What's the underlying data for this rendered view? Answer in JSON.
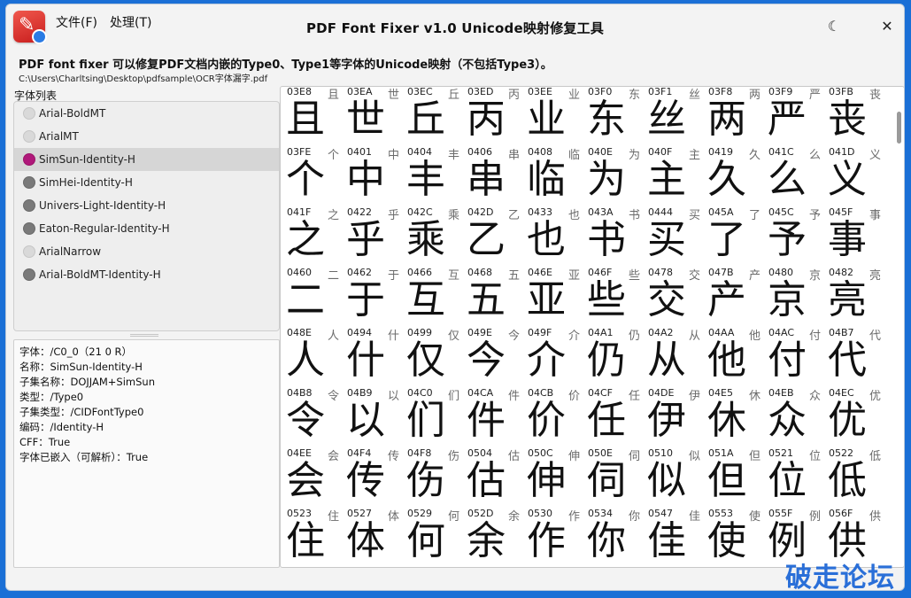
{
  "window": {
    "title": "PDF Font Fixer v1.0  Unicode映射修复工具",
    "menu": [
      "文件(F)",
      "处理(T)"
    ],
    "theme_icon": "moon-icon",
    "close_icon": "close-icon"
  },
  "header": {
    "description": "PDF font fixer 可以修复PDF文档内嵌的Type0、Type1等字体的Unicode映射（不包括Type3）。",
    "path": "C:\\Users\\Charltsing\\Desktop\\pdfsample\\OCR字体漏字.pdf"
  },
  "font_list": {
    "label": "字体列表",
    "items": [
      {
        "name": "Arial-BoldMT",
        "state": "light"
      },
      {
        "name": "ArialMT",
        "state": "light"
      },
      {
        "name": "SimSun-Identity-H",
        "state": "selected"
      },
      {
        "name": "SimHei-Identity-H",
        "state": "dark"
      },
      {
        "name": "Univers-Light-Identity-H",
        "state": "dark"
      },
      {
        "name": "Eaton-Regular-Identity-H",
        "state": "dark"
      },
      {
        "name": "ArialNarrow",
        "state": "light"
      },
      {
        "name": "Arial-BoldMT-Identity-H",
        "state": "dark"
      }
    ]
  },
  "info": {
    "lines": [
      "字体：/C0_0（21 0 R）",
      "名称：SimSun-Identity-H",
      "子集名称：DOJJAM+SimSun",
      "类型：/Type0",
      "子集类型：/CIDFontType0",
      "编码：/Identity-H",
      "CFF：True",
      "字体已嵌入（可解析）：True"
    ]
  },
  "glyphs": [
    {
      "code": "03E8",
      "char": "且"
    },
    {
      "code": "03EA",
      "char": "世"
    },
    {
      "code": "03EC",
      "char": "丘"
    },
    {
      "code": "03ED",
      "char": "丙"
    },
    {
      "code": "03EE",
      "char": "业"
    },
    {
      "code": "03F0",
      "char": "东"
    },
    {
      "code": "03F1",
      "char": "丝"
    },
    {
      "code": "03F8",
      "char": "两"
    },
    {
      "code": "03F9",
      "char": "严"
    },
    {
      "code": "03FB",
      "char": "丧"
    },
    {
      "code": "03FE",
      "char": "个"
    },
    {
      "code": "0401",
      "char": "中"
    },
    {
      "code": "0404",
      "char": "丰"
    },
    {
      "code": "0406",
      "char": "串"
    },
    {
      "code": "0408",
      "char": "临"
    },
    {
      "code": "040E",
      "char": "为"
    },
    {
      "code": "040F",
      "char": "主"
    },
    {
      "code": "0419",
      "char": "久"
    },
    {
      "code": "041C",
      "char": "么"
    },
    {
      "code": "041D",
      "char": "义"
    },
    {
      "code": "041F",
      "char": "之"
    },
    {
      "code": "0422",
      "char": "乎"
    },
    {
      "code": "042C",
      "char": "乘"
    },
    {
      "code": "042D",
      "char": "乙"
    },
    {
      "code": "0433",
      "char": "也"
    },
    {
      "code": "043A",
      "char": "书"
    },
    {
      "code": "0444",
      "char": "买"
    },
    {
      "code": "045A",
      "char": "了"
    },
    {
      "code": "045C",
      "char": "予"
    },
    {
      "code": "045F",
      "char": "事"
    },
    {
      "code": "0460",
      "char": "二"
    },
    {
      "code": "0462",
      "char": "于"
    },
    {
      "code": "0466",
      "char": "互"
    },
    {
      "code": "0468",
      "char": "五"
    },
    {
      "code": "046E",
      "char": "亚"
    },
    {
      "code": "046F",
      "char": "些"
    },
    {
      "code": "0478",
      "char": "交"
    },
    {
      "code": "047B",
      "char": "产"
    },
    {
      "code": "0480",
      "char": "京"
    },
    {
      "code": "0482",
      "char": "亮"
    },
    {
      "code": "048E",
      "char": "人"
    },
    {
      "code": "0494",
      "char": "什"
    },
    {
      "code": "0499",
      "char": "仅"
    },
    {
      "code": "049E",
      "char": "今"
    },
    {
      "code": "049F",
      "char": "介"
    },
    {
      "code": "04A1",
      "char": "仍"
    },
    {
      "code": "04A2",
      "char": "从"
    },
    {
      "code": "04AA",
      "char": "他"
    },
    {
      "code": "04AC",
      "char": "付"
    },
    {
      "code": "04B7",
      "char": "代"
    },
    {
      "code": "04B8",
      "char": "令"
    },
    {
      "code": "04B9",
      "char": "以"
    },
    {
      "code": "04C0",
      "char": "们"
    },
    {
      "code": "04CA",
      "char": "件"
    },
    {
      "code": "04CB",
      "char": "价"
    },
    {
      "code": "04CF",
      "char": "任"
    },
    {
      "code": "04DE",
      "char": "伊"
    },
    {
      "code": "04E5",
      "char": "休"
    },
    {
      "code": "04EB",
      "char": "众"
    },
    {
      "code": "04EC",
      "char": "优"
    },
    {
      "code": "04EE",
      "char": "会"
    },
    {
      "code": "04F4",
      "char": "传"
    },
    {
      "code": "04F8",
      "char": "伤"
    },
    {
      "code": "0504",
      "char": "估"
    },
    {
      "code": "050C",
      "char": "伸"
    },
    {
      "code": "050E",
      "char": "伺"
    },
    {
      "code": "0510",
      "char": "似"
    },
    {
      "code": "051A",
      "char": "但"
    },
    {
      "code": "0521",
      "char": "位"
    },
    {
      "code": "0522",
      "char": "低"
    },
    {
      "code": "0523",
      "char": "住"
    },
    {
      "code": "0527",
      "char": "体"
    },
    {
      "code": "0529",
      "char": "何"
    },
    {
      "code": "052D",
      "char": "余"
    },
    {
      "code": "0530",
      "char": "作"
    },
    {
      "code": "0534",
      "char": "你"
    },
    {
      "code": "0547",
      "char": "佳"
    },
    {
      "code": "0553",
      "char": "使"
    },
    {
      "code": "055F",
      "char": "例"
    },
    {
      "code": "056F",
      "char": "供"
    }
  ],
  "watermark": "破走论坛",
  "colors": {
    "accent": "#b0187a",
    "background": "#1a6fd6",
    "window": "#f3f3f3",
    "watermark": "#2a6fd8"
  }
}
